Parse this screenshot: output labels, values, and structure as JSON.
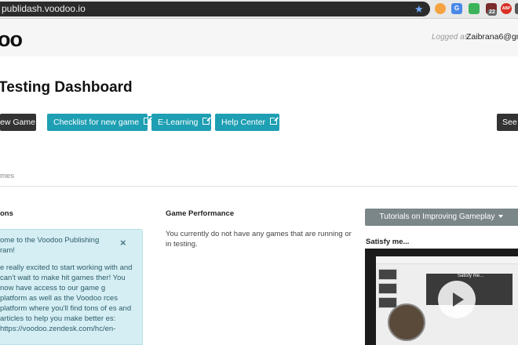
{
  "browser": {
    "url": "publidash.voodoo.io",
    "bookmark_icon": "star-icon",
    "extension_badge": "22",
    "extensions": [
      {
        "name": "extension-icon-1",
        "color": "#f4a340"
      },
      {
        "name": "extension-icon-2",
        "color": "#4a88e8"
      },
      {
        "name": "extension-icon-3",
        "color": "#3bb35a"
      },
      {
        "name": "extension-icon-4",
        "color": "#7a2a2a"
      },
      {
        "name": "adblock-icon",
        "color": "#d93025",
        "label": "ABP"
      },
      {
        "name": "extension-icon-6",
        "color": "#555555"
      }
    ]
  },
  "header": {
    "logo": "oo",
    "logged_label": "Logged as:",
    "user_email": "Zaibrana6@gma"
  },
  "page": {
    "title": "Testing Dashboard"
  },
  "actions": {
    "new_game": "ew Game",
    "checklist": "Checklist for new game",
    "elearning": "E-Learning",
    "help_center": "Help Center",
    "see": "See"
  },
  "tabs": {
    "games": "mes"
  },
  "notifications": {
    "heading": "ons",
    "alert_title": "ome to the Voodoo Publishing ram!",
    "alert_body": "e really excited to start working with and can't wait to make hit games ther! You now have access to our game g platform as well as the Voodoo rces platform where you'll find tons of es and articles to help you make better es: https://voodoo.zendesk.com/hc/en-",
    "close": "×"
  },
  "performance": {
    "heading": "Game Performance",
    "text": "You currently do not have any games that are running or in testing."
  },
  "tutorials": {
    "dropdown_label": "Tutorials on Improving Gameplay",
    "video_title": "Satisfy me...",
    "slide_text": "Satisfy me..."
  },
  "colors": {
    "teal": "#1e9fb3",
    "dark": "#333333",
    "alert_bg": "#d5eef3",
    "dropdown_bg": "#7b8689"
  }
}
